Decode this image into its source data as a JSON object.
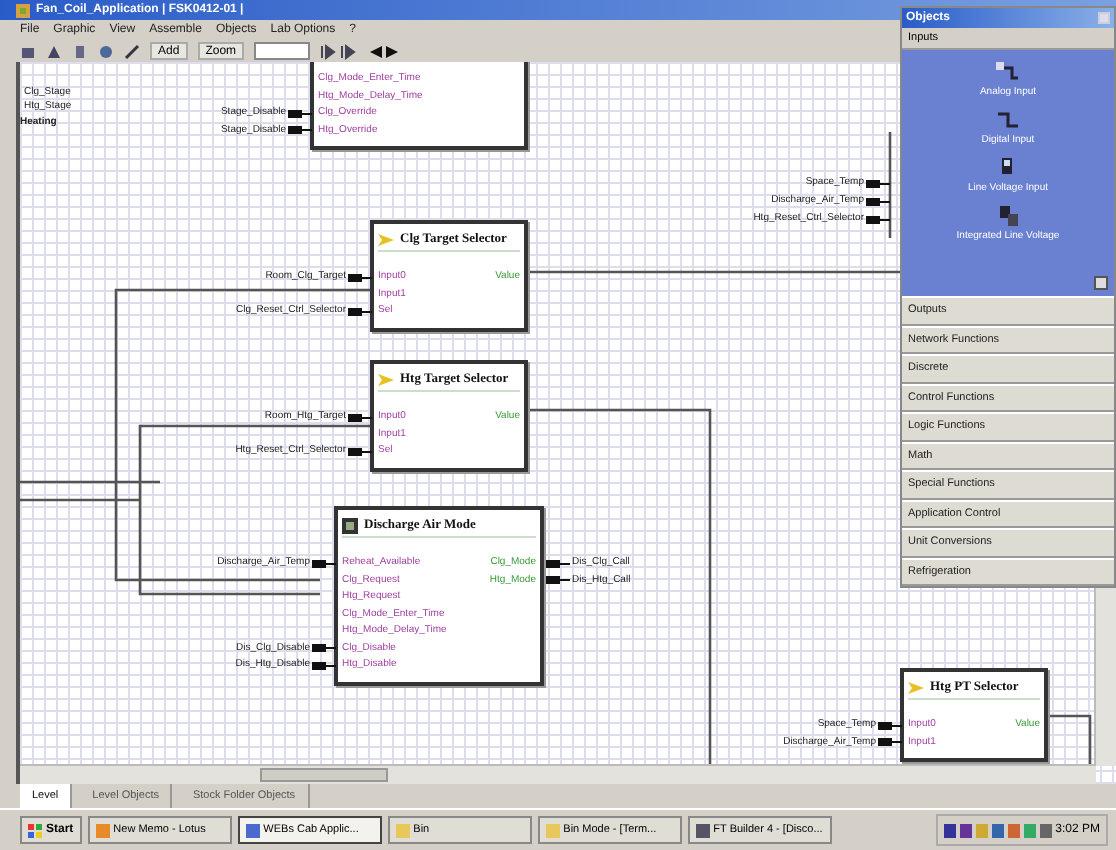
{
  "window": {
    "title": "Fan_Coil_Application | FSK0412-01 |"
  },
  "menu": [
    "File",
    "Graphic",
    "View",
    "Assemble",
    "Objects",
    "Lab Options",
    "?"
  ],
  "toolbar": {
    "add": "Add",
    "zoom": "Zoom"
  },
  "diagram": {
    "signals": [
      {
        "text": "Clg_Stage",
        "kind": "label"
      },
      {
        "text": "Htg_Stage",
        "kind": "label"
      },
      {
        "text": "Heating",
        "kind": "heading"
      },
      {
        "text": "Space_Temp",
        "kind": "tag"
      },
      {
        "text": "Discharge_Air_Temp",
        "kind": "tag"
      },
      {
        "text": "Htg_Reset_Ctrl_Selector",
        "kind": "tag"
      }
    ],
    "blocks": [
      {
        "kind": "partial",
        "inputs": [
          {
            "port": "Clg_Mode_Enter_Time"
          },
          {
            "port": "Htg_Mode_Delay_Time"
          },
          {
            "port": "Clg_Override",
            "wire": "Stage_Disable"
          },
          {
            "port": "Htg_Override",
            "wire": "Stage_Disable"
          }
        ]
      },
      {
        "kind": "selector",
        "title": "Clg Target Selector",
        "inputs": [
          {
            "port": "Input0",
            "wire": "Room_Clg_Target"
          },
          {
            "port": "Input1"
          },
          {
            "port": "Sel",
            "wire": "Clg_Reset_Ctrl_Selector"
          }
        ],
        "outputs": [
          {
            "port": "Value"
          }
        ]
      },
      {
        "kind": "selector",
        "title": "Htg Target Selector",
        "inputs": [
          {
            "port": "Input0",
            "wire": "Room_Htg_Target"
          },
          {
            "port": "Input1"
          },
          {
            "port": "Sel",
            "wire": "Htg_Reset_Ctrl_Selector"
          }
        ],
        "outputs": [
          {
            "port": "Value"
          }
        ]
      },
      {
        "kind": "mode",
        "title": "Discharge Air Mode",
        "inputs": [
          {
            "port": "Reheat_Available",
            "wire": "Discharge_Air_Temp"
          },
          {
            "port": "Clg_Request"
          },
          {
            "port": "Htg_Request"
          },
          {
            "port": "Clg_Mode_Enter_Time"
          },
          {
            "port": "Htg_Mode_Delay_Time"
          },
          {
            "port": "Clg_Disable",
            "wire": "Dis_Clg_Disable"
          },
          {
            "port": "Htg_Disable",
            "wire": "Dis_Htg_Disable"
          }
        ],
        "outputs": [
          {
            "port": "Clg_Mode",
            "wire": "Dis_Clg_Call"
          },
          {
            "port": "Htg_Mode",
            "wire": "Dis_Htg_Call"
          }
        ]
      },
      {
        "kind": "selector",
        "title": "Htg PT Selector",
        "inputs": [
          {
            "port": "Input0",
            "wire": "Space_Temp"
          },
          {
            "port": "Input1",
            "wire": "Discharge_Air_Temp"
          }
        ],
        "outputs": [
          {
            "port": "Value"
          }
        ]
      }
    ]
  },
  "objects_panel": {
    "title": "Objects",
    "section": "Inputs",
    "items": [
      {
        "label": "Analog Input"
      },
      {
        "label": "Digital Input"
      },
      {
        "label": "Line Voltage Input"
      },
      {
        "label": "Integrated Line Voltage"
      }
    ],
    "categories": [
      "Outputs",
      "Network Functions",
      "Discrete",
      "Control Functions",
      "Logic Functions",
      "Math",
      "Special Functions",
      "Application Control",
      "Unit Conversions",
      "Refrigeration"
    ]
  },
  "view_tabs": [
    {
      "label": "Level",
      "selected": true
    },
    {
      "label": "Level Objects",
      "selected": false
    },
    {
      "label": "Stock Folder Objects",
      "selected": false
    }
  ],
  "taskbar": {
    "start": "Start",
    "tasks": [
      {
        "label": "New Memo - Lotus",
        "selected": false
      },
      {
        "label": "WEBs Cab Applic...",
        "selected": true
      },
      {
        "label": "Bin",
        "selected": false
      },
      {
        "label": "Bin Mode - [Term...",
        "selected": false
      },
      {
        "label": "FT Builder 4 - [Disco...",
        "selected": false
      }
    ],
    "clock": "3:02 PM"
  }
}
